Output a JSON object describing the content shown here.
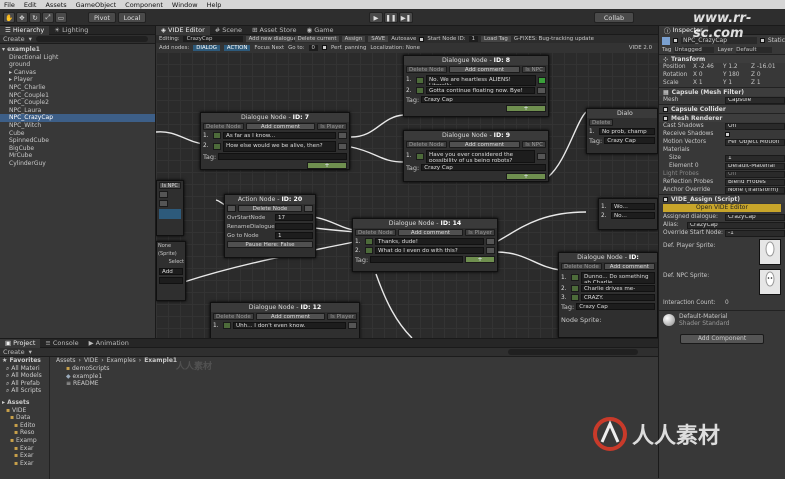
{
  "menu": {
    "items": [
      "File",
      "Edit",
      "Assets",
      "GameObject",
      "Component",
      "Window",
      "Help"
    ]
  },
  "toolbar": {
    "pivot": "Pivot",
    "local": "Local",
    "collab": "Collab",
    "layers": "Layers",
    "layout": "Layout"
  },
  "watermark": {
    "url": "www.rr-sc.com",
    "logo": "人人素材",
    "ghost": "人人素材"
  },
  "hierarchy": {
    "tab": "Hierarchy",
    "create": "Create",
    "search_placeholder": "",
    "items": [
      {
        "label": "example1",
        "level": "root"
      },
      {
        "label": "Directional Light"
      },
      {
        "label": "ground"
      },
      {
        "label": "Canvas",
        "expandable": true
      },
      {
        "label": "Player",
        "expandable": true
      },
      {
        "label": "NPC_Charlie"
      },
      {
        "label": "NPC_Couple1"
      },
      {
        "label": "NPC_Couple2"
      },
      {
        "label": "NPC_Laura"
      },
      {
        "label": "NPC_CrazyCap",
        "selected": true
      },
      {
        "label": "NPC_Witch"
      },
      {
        "label": "Cube"
      },
      {
        "label": "SpinnedCube"
      },
      {
        "label": "BigCube"
      },
      {
        "label": "MrCube"
      },
      {
        "label": "CylinderGuy"
      }
    ]
  },
  "lighting_tab": "Lighting",
  "center_tabs": {
    "vide": "VIDE Editor",
    "scene": "Scene",
    "asset_store": "Asset Store",
    "game": "Game"
  },
  "vide_bar": {
    "editing_label": "Editing:",
    "editing_value": "CrazyCap",
    "add_dialogue": "Add new dialogue",
    "delete_current": "Delete current",
    "assign": "Assign",
    "save": "SAVE",
    "autosave": "Autosave",
    "start_node_label": "Start Node ID:",
    "start_node_value": "1",
    "load_tag": "Load Tag",
    "fixes": "G-FIXES: Bug-tracking update",
    "add_nodes": "Add nodes:",
    "btn_dialog": "DIALOG",
    "btn_action": "ACTION",
    "focus_next": "Focus Next",
    "goto": "Go to:",
    "goto_value": "0",
    "perf": "Perf. panning",
    "localization": "Localization: None",
    "version": "VIDE 2.0"
  },
  "nodes": {
    "n7": {
      "title": "Dialogue Node",
      "id": "ID: 7",
      "delete": "Delete Node",
      "add": "Add comment",
      "is_player": "Is Player",
      "comments": [
        {
          "n": "1.",
          "text": "As far as I know..."
        },
        {
          "n": "2.",
          "text": "How else would we be alive, then?"
        }
      ],
      "tag_label": "Tag:",
      "tag": ""
    },
    "n8": {
      "title": "Dialogue Node",
      "id": "ID: 8",
      "delete": "Delete Node",
      "add": "Add comment",
      "is_player": "Is NPC",
      "comments": [
        {
          "n": "1.",
          "text": "No. We are heartless ALIENS! Literally."
        },
        {
          "n": "2.",
          "text": "Gotta continue floating now. Bye!"
        }
      ],
      "tag_label": "Tag:",
      "tag": "Crazy Cap"
    },
    "n9": {
      "title": "Dialogue Node",
      "id": "ID: 9",
      "delete": "Delete Node",
      "add": "Add comment",
      "is_player": "Is NPC",
      "comments": [
        {
          "n": "1.",
          "text": "Have you ever considered the possibility of us being robots?"
        }
      ],
      "tag_label": "Tag:",
      "tag": "Crazy Cap"
    },
    "n14": {
      "title": "Dialogue Node",
      "id": "ID: 14",
      "delete": "Delete Node",
      "add": "Add comment",
      "is_player": "Is Player",
      "comments": [
        {
          "n": "1.",
          "text": "Thanks, dude!"
        },
        {
          "n": "2.",
          "text": "What do I even do with this?"
        }
      ],
      "tag_label": "Tag:",
      "tag": ""
    },
    "n20": {
      "title": "Action Node",
      "id": "ID: 20",
      "delete": "Delete Node",
      "ovr_label": "OvrStartNode",
      "ovr_value": "17",
      "rename_label": "RenameDialogue",
      "rename_value": "",
      "goto_label": "Go to Node",
      "goto_value": "1",
      "pause": "Pause Here: False"
    },
    "n12": {
      "title": "Dialogue Node",
      "id": "ID: 12",
      "delete": "Delete Node",
      "add": "Add comment",
      "is_player": "Is Player",
      "comments": [
        {
          "n": "1.",
          "text": "Uhh... I don't even know."
        }
      ]
    },
    "nright": {
      "title": "Dialogue Node",
      "id": "ID:",
      "delete": "Delete Node",
      "add": "Add comment",
      "comments": [
        {
          "n": "1.",
          "text": "Dunno... Do something ab Charlie"
        },
        {
          "n": "2.",
          "text": "Charlie drives me-"
        },
        {
          "n": "3.",
          "text": "CRAZY."
        }
      ],
      "tag_label": "Tag:",
      "tag": "Crazy Cap",
      "sprite_label": "Node Sprite:"
    },
    "nfar": {
      "title": "Dialo",
      "delete": "Delete",
      "comments": [
        {
          "n": "1.",
          "text": "No prob, champ"
        }
      ],
      "tag_label": "Tag:",
      "tag": "Crazy Cap",
      "c2": "Wo...",
      "c3": "No..."
    },
    "nleft": {
      "is_npc": "Is NPC",
      "sprite": "(Sprite)",
      "none": "None",
      "select": "Select",
      "add": "Add"
    }
  },
  "bottom_tabs": {
    "project": "Project",
    "console": "Console",
    "animation": "Animation",
    "create": "Create"
  },
  "project": {
    "favorites": "Favorites",
    "fav_items": [
      "All Materi",
      "All Models",
      "All Prefab",
      "All Scripts"
    ],
    "assets": "Assets",
    "tree": [
      "VIDE",
      "Data",
      "Edito",
      "Reso",
      "Examp",
      "Exar",
      "Exar",
      "Exar"
    ],
    "breadcrumb": [
      "Assets",
      "VIDE",
      "Examples",
      "Example1"
    ],
    "files": [
      {
        "name": "demoScripts",
        "type": "folder"
      },
      {
        "name": "example1",
        "type": "scene"
      },
      {
        "name": "README",
        "type": "text"
      }
    ]
  },
  "inspector": {
    "tab": "Inspector",
    "object_name": "NPC_CrazyCap",
    "static": "Static",
    "tag_label": "Tag",
    "tag_value": "Untagged",
    "layer_label": "Layer",
    "layer_value": "Default",
    "transform": "Transform",
    "position": {
      "label": "Position",
      "x": "-2.46",
      "y": "1.2",
      "z": "-16.01"
    },
    "rotation": {
      "label": "Rotation",
      "x": "0",
      "y": "180",
      "z": "0"
    },
    "scale": {
      "label": "Scale",
      "x": "1",
      "y": "1",
      "z": "1"
    },
    "mesh_filter": "Capsule (Mesh Filter)",
    "mesh_label": "Mesh",
    "mesh_value": "Capsule",
    "capsule_collider": "Capsule Collider",
    "mesh_renderer": "Mesh Renderer",
    "cast_shadows": {
      "label": "Cast Shadows",
      "value": "On"
    },
    "receive_shadows": {
      "label": "Receive Shadows",
      "value": ""
    },
    "motion_vectors": {
      "label": "Motion Vectors",
      "value": "Per Object Motion"
    },
    "materials": "Materials",
    "size": {
      "label": "Size",
      "value": "1"
    },
    "element0": {
      "label": "Element 0",
      "value": "Default-Material"
    },
    "light_probes": {
      "label": "Light Probes",
      "value": "Off"
    },
    "reflection_probes": {
      "label": "Reflection Probes",
      "value": "Blend Probes"
    },
    "anchor_override": {
      "label": "Anchor Override",
      "value": "None (Transform)"
    },
    "vide_assign": "VIDE_Assign (Script)",
    "open_vide": "Open VIDE Editor",
    "assigned": {
      "label": "Assigned dialogue:",
      "value": "CrazyCap"
    },
    "alias": {
      "label": "Alias:",
      "value": "CrazyCap"
    },
    "override": {
      "label": "Override Start Node:",
      "value": "-1"
    },
    "player_sprite": "Def. Player Sprite:",
    "npc_sprite": "Def. NPC Sprite:",
    "select": "Select",
    "interaction": {
      "label": "Interaction Count:",
      "value": "0"
    },
    "material_name": "Default-Material",
    "shader_label": "Shader",
    "shader_value": "Standard",
    "add_component": "Add Component"
  },
  "colors": {
    "accent": "#3d5f88",
    "yellow": "#c8a52a",
    "node_green": "#6f8f4f"
  }
}
